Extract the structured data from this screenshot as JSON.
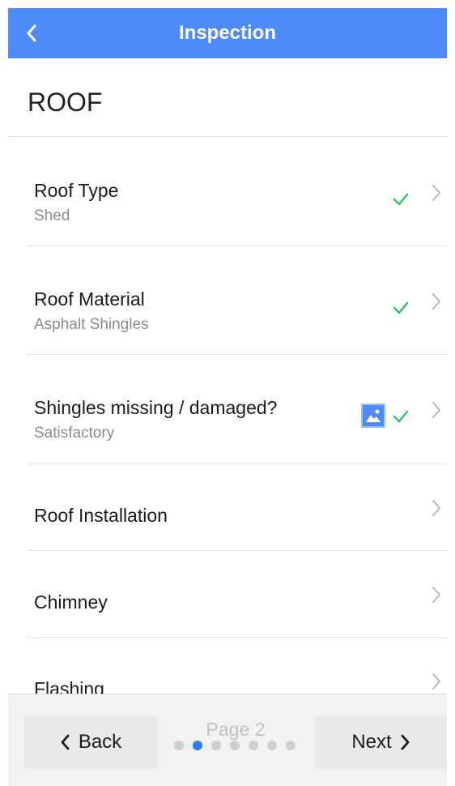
{
  "navbar": {
    "title": "Inspection",
    "back_icon": "chevron-left-icon"
  },
  "section": {
    "title": "ROOF"
  },
  "rows": [
    {
      "label": "Roof Type",
      "value": "Shed",
      "status": "check-icon"
    },
    {
      "label": "Roof Material",
      "value": "Asphalt Shingles",
      "status": "check-icon"
    },
    {
      "label": "Shingles missing / damaged?",
      "value": "Satisfactory",
      "status": "check-icon",
      "attachment": "photo-icon"
    },
    {
      "label": "Roof Installation"
    },
    {
      "label": "Chimney"
    },
    {
      "label": "Flashing"
    }
  ],
  "footer": {
    "back_label": "Back",
    "next_label": "Next",
    "page_label": "Page 2",
    "current_page": 2,
    "total_pages": 7
  },
  "colors": {
    "accent": "#4d8bf8",
    "check": "#2ec36b",
    "dot_active": "#2f7cf6"
  }
}
